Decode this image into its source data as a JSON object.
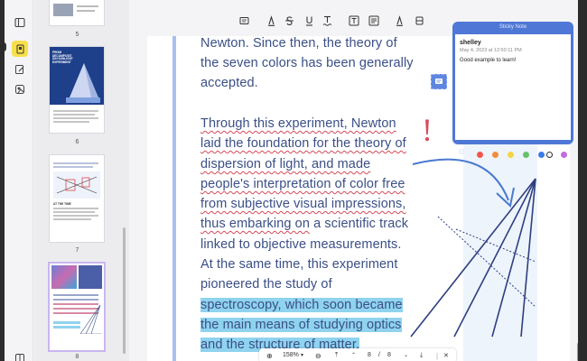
{
  "thumbnails": [
    {
      "page_label": "5"
    },
    {
      "page_label": "6",
      "cover_title": "PRISM\nDECOMPOSIT\nION SUNLIGHT\nEXPERIMENT"
    },
    {
      "page_label": "7",
      "heading": "AT THE TIME"
    },
    {
      "page_label": "8"
    }
  ],
  "document": {
    "lines": [
      "Newton. Since then, the theory of",
      "the seven colors has been generally",
      "accepted.",
      "Through this experiment, Newton",
      "laid the foundation for the theory of",
      "dispersion of light, and made",
      "people's interpretation of color free",
      "from subjective visual impressions,",
      "thus embarking on",
      " a scientific track",
      "linked to objective measurements.",
      "At the same time, this experiment",
      "pioneered the study of",
      "spectroscopy, which soon became",
      "the main means of studying optics",
      "and the structure of matter."
    ],
    "exclamation": "!"
  },
  "sticky_note": {
    "title": "Sticky Note",
    "user": "shelley",
    "date": "May 4, 2023 at 12:50:11 PM",
    "message": "Good example to learn!",
    "colors": [
      "#f2554d",
      "#f28c3a",
      "#f6d544",
      "#66c26a",
      "#3a7be8",
      "#2f2f2f",
      "#c46be0"
    ]
  },
  "navigation": {
    "zoom": "158%",
    "current_page": "8",
    "separator": "/",
    "total_pages": "8"
  },
  "colors": {
    "text": "#3a4f86",
    "highlight": "#8fd3ef",
    "sticky": "#4f77d6",
    "squiggle": "#d44a5a"
  }
}
